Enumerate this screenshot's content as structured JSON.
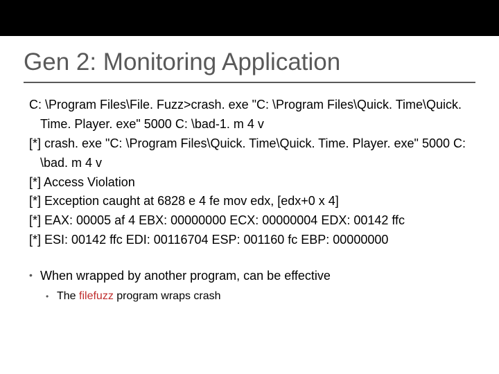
{
  "slide": {
    "title": "Gen 2: Monitoring Application",
    "terminal": {
      "l1": "C: \\Program Files\\File. Fuzz>crash. exe \"C: \\Program Files\\Quick. Time\\Quick. Time. Player. exe\" 5000 C: \\bad-1. m 4 v",
      "l2": "[*] crash. exe \"C: \\Program Files\\Quick. Time\\Quick. Time. Player. exe\" 5000 C: \\bad. m 4 v",
      "l3": "[*] Access Violation",
      "l4": "[*] Exception caught at 6828 e 4 fe mov edx, [edx+0 x 4]",
      "l5": "[*] EAX: 00005 af 4 EBX: 00000000 ECX: 00000004 EDX: 00142 ffc",
      "l6": "[*] ESI: 00142 ffc EDI: 00116704 ESP: 001160 fc EBP: 00000000"
    },
    "bullets": {
      "b1": "When wrapped by another program, can be effective",
      "b2_pre": "The ",
      "b2_hl": "filefuzz",
      "b2_post": " program wraps crash"
    }
  }
}
